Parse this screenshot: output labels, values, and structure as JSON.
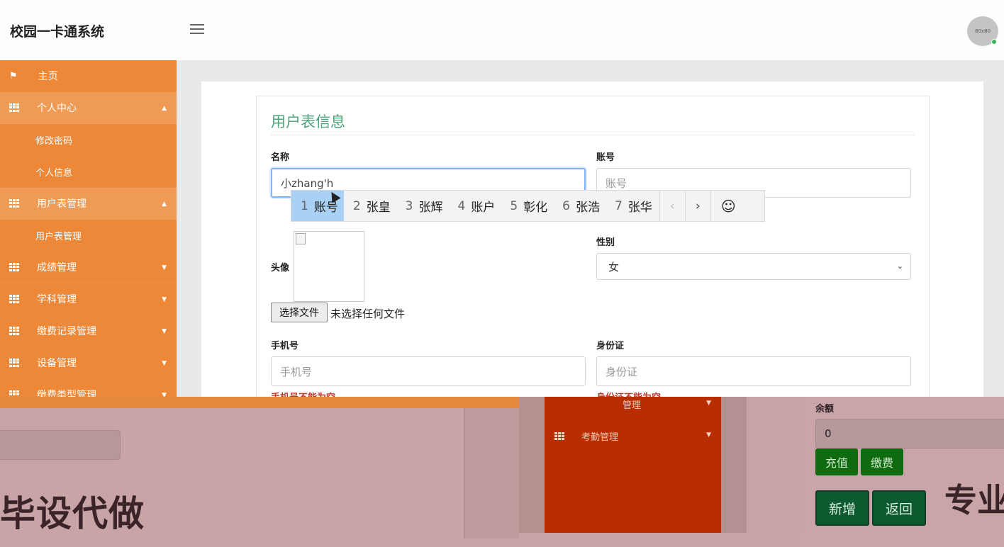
{
  "app": {
    "title": "校园一卡通系统",
    "avatar_text": "80x80"
  },
  "sidebar": {
    "items": [
      {
        "label": "主页"
      },
      {
        "label": "个人中心"
      },
      {
        "label": "修改密码"
      },
      {
        "label": "个人信息"
      },
      {
        "label": "用户表管理"
      },
      {
        "label": "用户表管理"
      },
      {
        "label": "成绩管理"
      },
      {
        "label": "学科管理"
      },
      {
        "label": "缴费记录管理"
      },
      {
        "label": "设备管理"
      },
      {
        "label": "缴费类型管理"
      }
    ]
  },
  "form": {
    "title": "用户表信息",
    "name": {
      "label": "名称",
      "value": "小zhang'h"
    },
    "account": {
      "label": "账号",
      "placeholder": "账号"
    },
    "avatar": {
      "label": "头像"
    },
    "file": {
      "button": "选择文件",
      "status": "未选择任何文件"
    },
    "gender": {
      "label": "性别",
      "selected": "女"
    },
    "phone": {
      "label": "手机号",
      "placeholder": "手机号",
      "error": "手机号不能为空"
    },
    "idcard": {
      "label": "身份证",
      "placeholder": "身份证",
      "error": "身份证不能为空"
    }
  },
  "ime": {
    "candidates": [
      {
        "num": "1",
        "text": "账号"
      },
      {
        "num": "2",
        "text": "张皇"
      },
      {
        "num": "3",
        "text": "张辉"
      },
      {
        "num": "4",
        "text": "账户"
      },
      {
        "num": "5",
        "text": "彰化"
      },
      {
        "num": "6",
        "text": "张浩"
      },
      {
        "num": "7",
        "text": "张华"
      }
    ],
    "prev": "‹",
    "next": "›",
    "emoji": "☺"
  },
  "overlay": {
    "big_text_left": "毕设代做",
    "big_text_right": "专业",
    "menu_item_1": "管理",
    "menu_item_2": "考勤管理",
    "balance_label": "余额",
    "balance_value": "0",
    "recharge_button": "充值",
    "pay_button": "缴费",
    "add_button": "新增",
    "back_button": "返回"
  }
}
